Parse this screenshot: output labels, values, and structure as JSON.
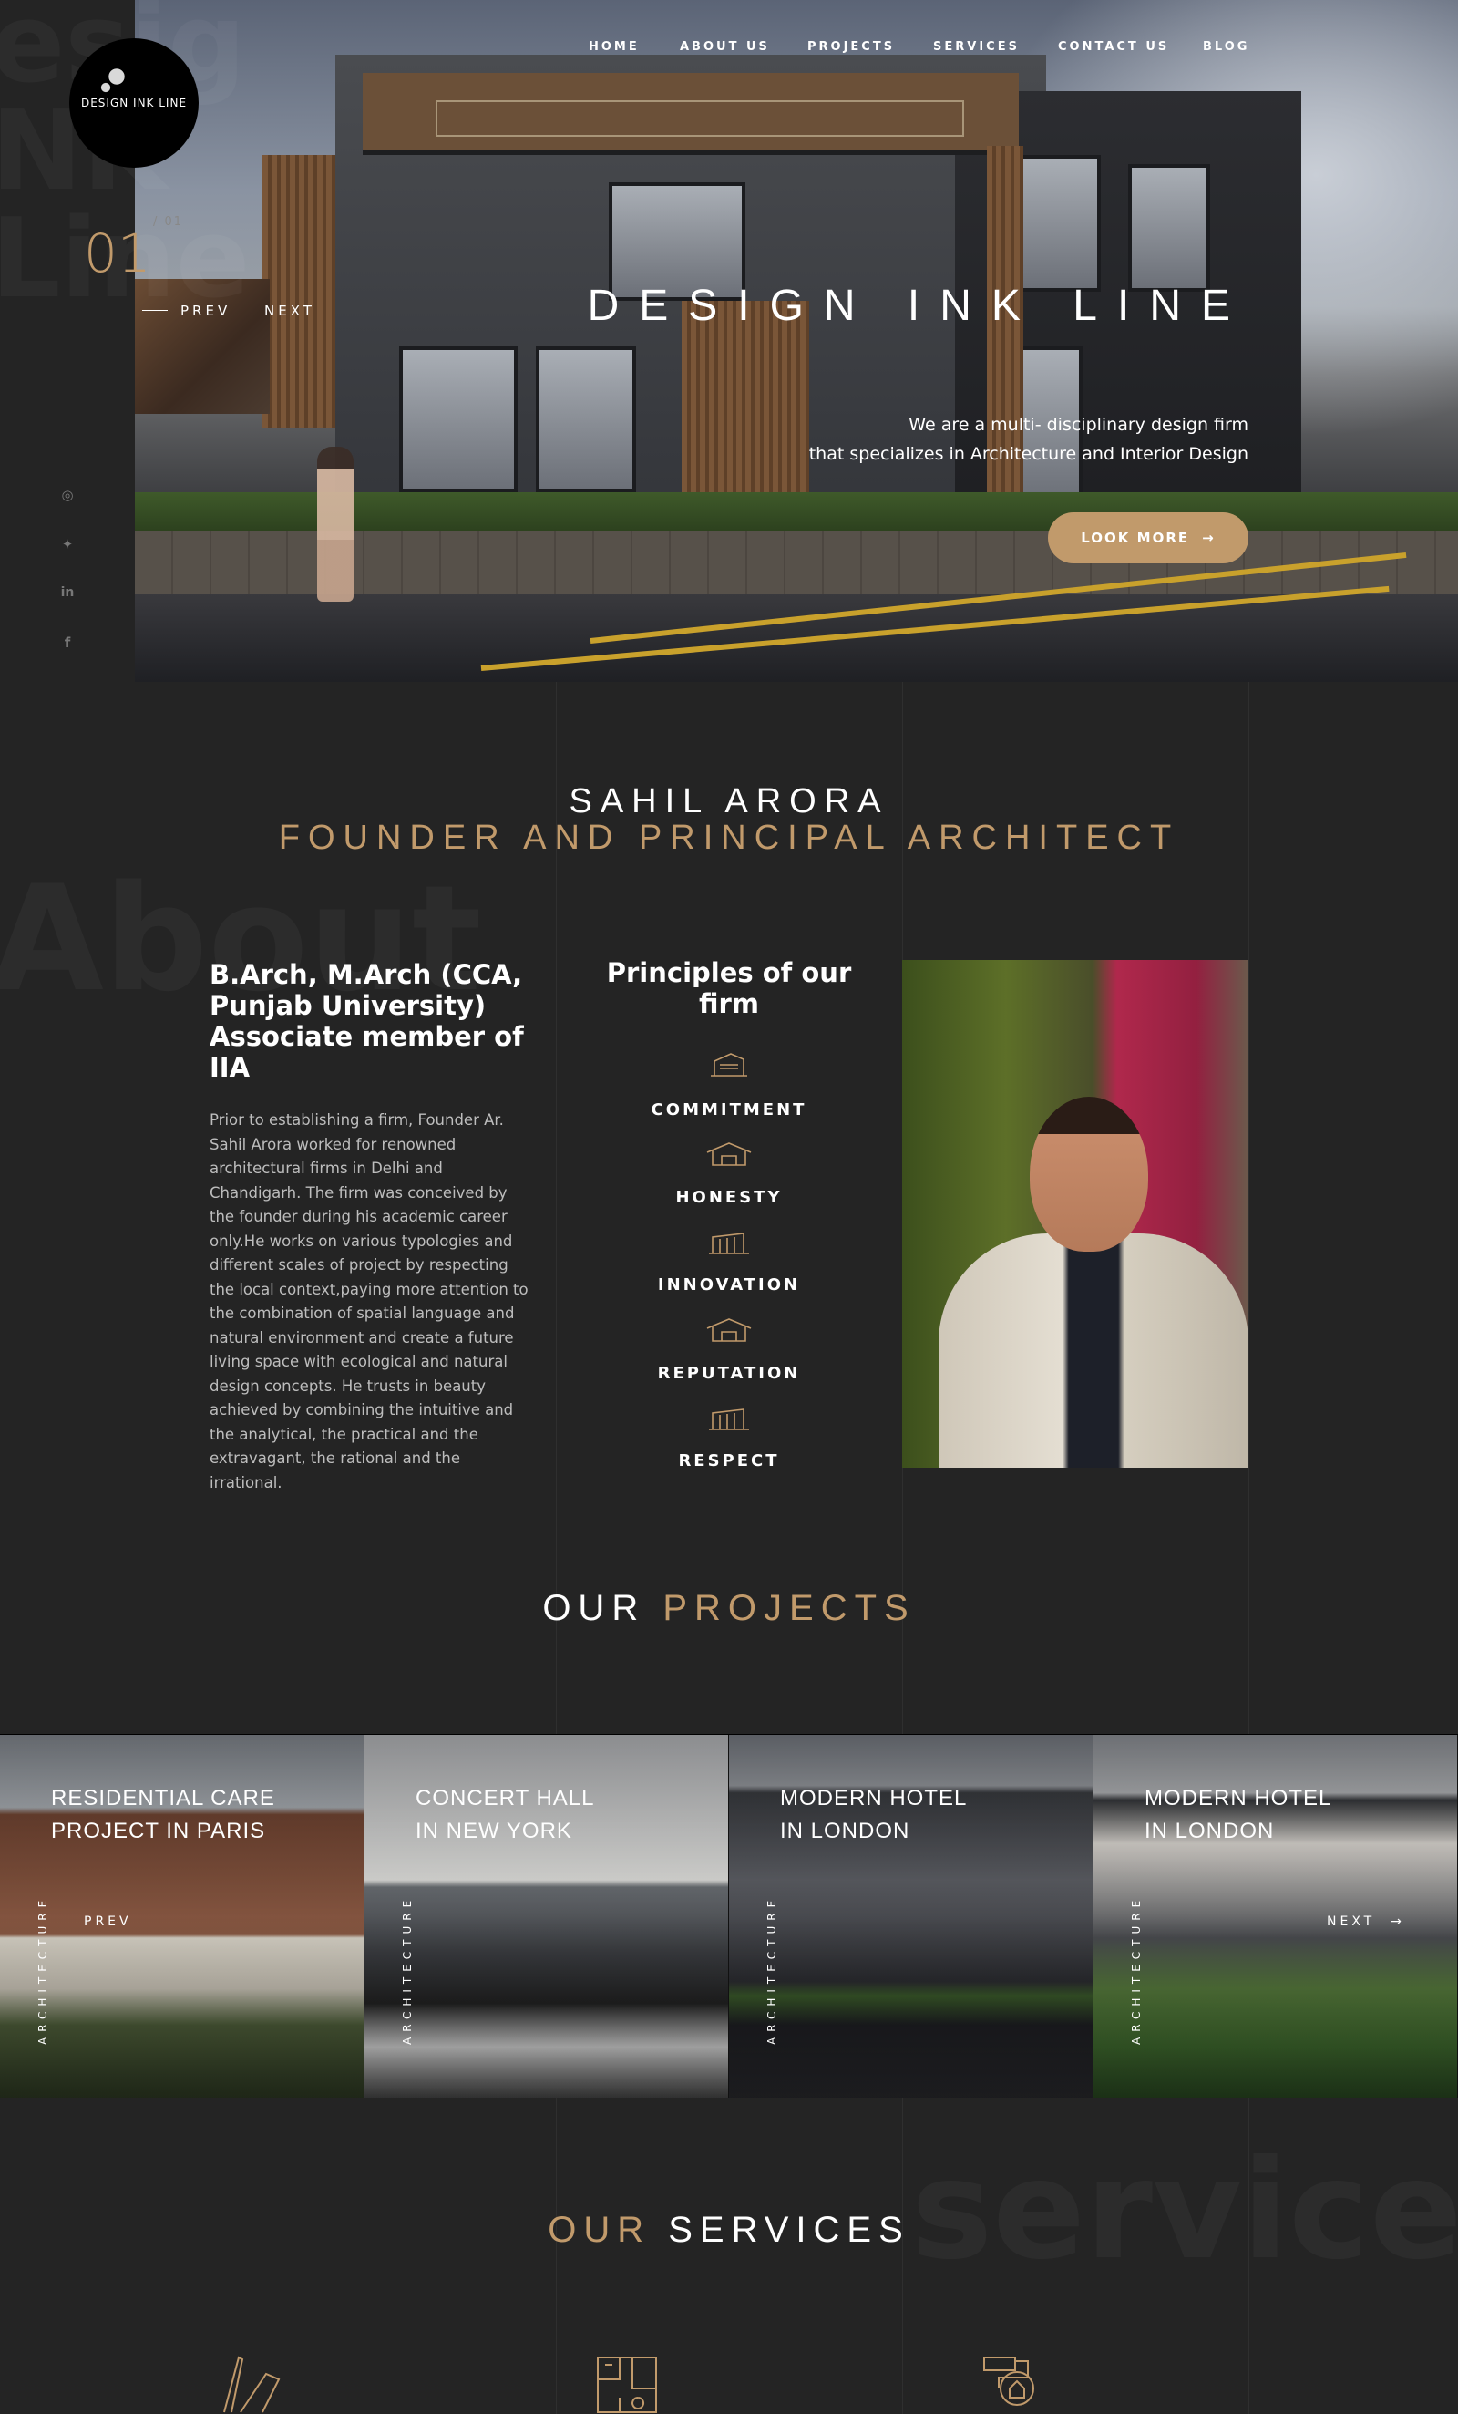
{
  "brand": {
    "logo_text": "DESIGN INK LINE"
  },
  "nav": {
    "items": [
      "HOME",
      "ABOUT US",
      "PROJECTS",
      "SERVICES",
      "CONTACT US",
      "BLOG"
    ]
  },
  "hero": {
    "slide_current": "01",
    "slide_total": "/ 01",
    "prev_label": "PREV",
    "next_label": "NEXT",
    "title": "DESIGN INK LINE",
    "subtitle_line1": "We are a multi- disciplinary design firm",
    "subtitle_line2": "that specializes in Architecture and Interior Design",
    "cta_label": "LOOK MORE",
    "cta_icon": "arrow-right-icon"
  },
  "social": {
    "icons": [
      "instagram-icon",
      "twitter-icon",
      "linkedin-icon",
      "facebook-icon"
    ]
  },
  "about": {
    "watermark": "About",
    "founder_name": "SAHIL ARORA",
    "founder_role": "FOUNDER AND PRINCIPAL ARCHITECT",
    "qualifications": "B.Arch, M.Arch (CCA, Punjab University) Associate member of IIA",
    "bio": "Prior to establishing a firm, Founder Ar. Sahil Arora worked for renowned architectural firms in Delhi and Chandigarh. The firm was conceived by the founder during his academic career only.He works on various typologies and different scales of project by respecting the local context,paying more attention to the combination of spatial language and natural environment and create a future living space with ecological and natural design concepts. He trusts in beauty achieved by combining the intuitive and the analytical, the practical and the extravagant, the rational and the irrational.",
    "principles_title": "Principles of our firm",
    "principles": [
      "COMMITMENT",
      "HONESTY",
      "INNOVATION",
      "REPUTATION",
      "RESPECT"
    ]
  },
  "projects": {
    "title_word1": "OUR",
    "title_word2": "PROJECTS",
    "prev_label": "PREV",
    "next_label": "NEXT",
    "items": [
      {
        "title_line1": "RESIDENTIAL CARE",
        "title_line2": "PROJECT IN PARIS",
        "category": "ARCHITECTURE"
      },
      {
        "title_line1": "CONCERT HALL",
        "title_line2": "IN NEW YORK",
        "category": "ARCHITECTURE"
      },
      {
        "title_line1": "MODERN HOTEL",
        "title_line2": "IN LONDON",
        "category": "ARCHITECTURE"
      },
      {
        "title_line1": "MODERN HOTEL",
        "title_line2": "IN LONDON",
        "category": "ARCHITECTURE"
      }
    ]
  },
  "services": {
    "watermark": "service",
    "title_word1": "OUR",
    "title_word2": "SERVICES",
    "icons": [
      "architecture-icon",
      "floor-plan-icon",
      "interior-design-icon"
    ]
  },
  "colors": {
    "accent": "#c19a6b",
    "background": "#242424"
  }
}
